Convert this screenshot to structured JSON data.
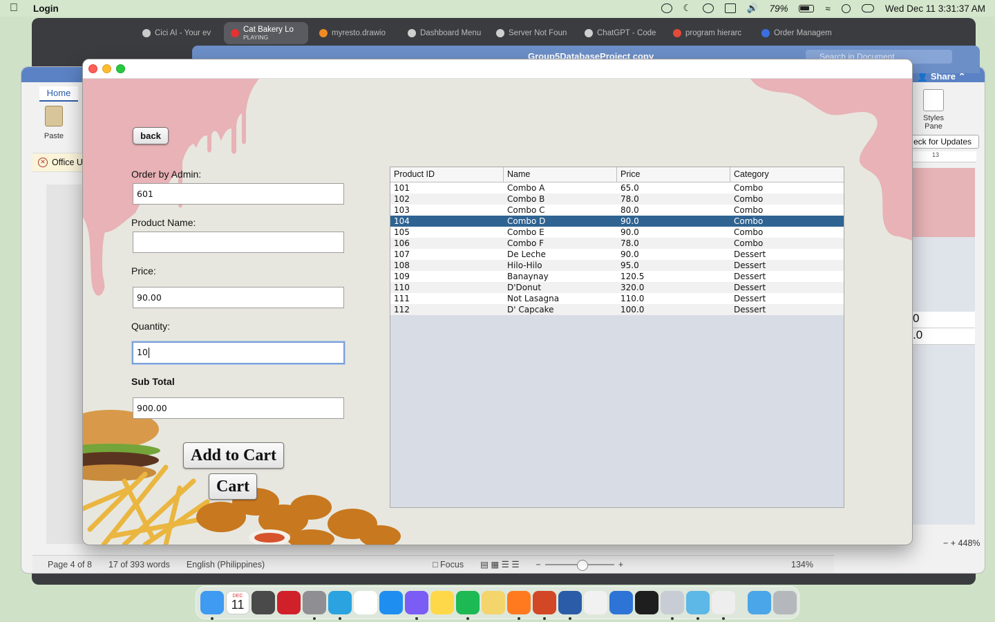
{
  "menubar": {
    "app_name": "Login",
    "battery": "79%",
    "clock": "Wed Dec 11  3:31:37 AM"
  },
  "browser": {
    "tabs": [
      {
        "title": "Cici AI - Your ev",
        "sub": "",
        "color": "#c9c9c9"
      },
      {
        "title": "Cat Bakery Lo",
        "sub": "PLAYING",
        "color": "#e23232"
      },
      {
        "title": "myresto.drawio",
        "sub": "",
        "color": "#f08a24"
      },
      {
        "title": "Dashboard Menu",
        "sub": "",
        "color": "#cfcfcf"
      },
      {
        "title": "Server Not Foun",
        "sub": "",
        "color": "#cfcfcf"
      },
      {
        "title": "ChatGPT - Code",
        "sub": "",
        "color": "#cfcfcf"
      },
      {
        "title": "program hierarc",
        "sub": "",
        "color": "#e24a3b"
      },
      {
        "title": "Order Managem",
        "sub": "",
        "color": "#3a6fe2"
      }
    ]
  },
  "word": {
    "home_tab": "Home",
    "paste_label": "Paste",
    "office_bar": "Office U",
    "share": "Share",
    "styles_pane": "Styles Pane",
    "check_updates": "eck for Updates",
    "ruler_num": "13",
    "doc_cells": [
      "0",
      ".0"
    ],
    "zoom_right": "448%",
    "status": {
      "page": "Page 4 of 8",
      "words": "17 of 393 words",
      "language": "English (Philippines)",
      "focus": "Focus",
      "zoom": "134%"
    }
  },
  "db_window": {
    "title": "Group5DatabaseProject copy",
    "search_placeholder": "Search in Document"
  },
  "app": {
    "back_label": "back",
    "order_label": "Order by Admin:",
    "order_value": "601",
    "product_label": "Product Name:",
    "product_value": "",
    "price_label": "Price:",
    "price_value": "90.00",
    "qty_label": "Quantity:",
    "qty_value": "10",
    "subtotal_label": "Sub Total",
    "subtotal_value": "900.00",
    "add_to_cart": "Add to Cart",
    "cart": "Cart"
  },
  "table": {
    "columns": [
      "Product ID",
      "Name",
      "Price",
      "Category"
    ],
    "selected_index": 3,
    "rows": [
      [
        "101",
        "Combo A",
        "65.0",
        "Combo"
      ],
      [
        "102",
        "Combo B",
        "78.0",
        "Combo"
      ],
      [
        "103",
        "Combo C",
        "80.0",
        "Combo"
      ],
      [
        "104",
        "Combo D",
        "90.0",
        "Combo"
      ],
      [
        "105",
        "Combo E",
        "90.0",
        "Combo"
      ],
      [
        "106",
        "Combo F",
        "78.0",
        "Combo"
      ],
      [
        "107",
        "De Leche",
        "90.0",
        "Dessert"
      ],
      [
        "108",
        "Hilo-Hilo",
        "95.0",
        "Dessert"
      ],
      [
        "109",
        "Banaynay",
        "120.5",
        "Dessert"
      ],
      [
        "110",
        "D'Donut",
        "320.0",
        "Dessert"
      ],
      [
        "111",
        "Not Lasagna",
        "110.0",
        "Dessert"
      ],
      [
        "112",
        "D' Capcake",
        "100.0",
        "Dessert"
      ]
    ]
  },
  "dock": {
    "calendar_month": "DEC",
    "calendar_day": "11",
    "apps": [
      {
        "icon": "finder-icon",
        "color": "#3f9af2"
      },
      {
        "icon": "calendar-icon",
        "color": "#ffffff"
      },
      {
        "icon": "calculator-icon",
        "color": "#4a4a4a"
      },
      {
        "icon": "photo-booth-icon",
        "color": "#d0202a"
      },
      {
        "icon": "system-settings-icon",
        "color": "#8e8e93"
      },
      {
        "icon": "telegram-icon",
        "color": "#2aa3e0"
      },
      {
        "icon": "reminders-icon",
        "color": "#ffffff"
      },
      {
        "icon": "safari-icon",
        "color": "#1e8ff0"
      },
      {
        "icon": "messenger-icon",
        "color": "#7b5cf5"
      },
      {
        "icon": "notes-icon",
        "color": "#ffd84a"
      },
      {
        "icon": "spotify-icon",
        "color": "#1db954"
      },
      {
        "icon": "stickies-icon",
        "color": "#f3d56b"
      },
      {
        "icon": "firefox-icon",
        "color": "#ff7a1f"
      },
      {
        "icon": "powerpoint-icon",
        "color": "#d24726"
      },
      {
        "icon": "word-icon",
        "color": "#2b5ca8"
      },
      {
        "icon": "code-app-icon",
        "color": "#f1f1f1"
      },
      {
        "icon": "quicktime-icon",
        "color": "#2e74d6"
      },
      {
        "icon": "terminal-icon",
        "color": "#1e1e1e"
      },
      {
        "icon": "utility-gear-icon",
        "color": "#c8ccd4"
      },
      {
        "icon": "netbeans-icon",
        "color": "#5db8e8"
      },
      {
        "icon": "java-icon",
        "color": "#eeeeee"
      }
    ],
    "trailing": [
      {
        "icon": "downloads-icon",
        "color": "#4aa6e8"
      },
      {
        "icon": "trash-icon",
        "color": "#b4b8bc"
      }
    ]
  }
}
